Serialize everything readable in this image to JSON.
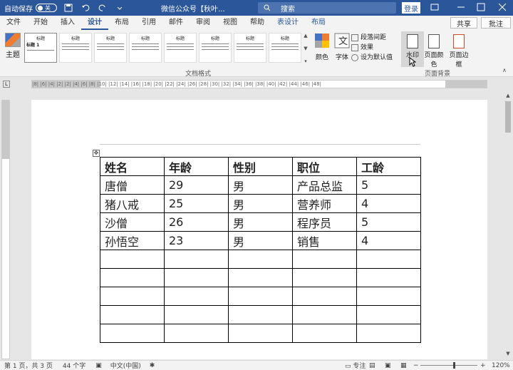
{
  "titlebar": {
    "autosave_label": "自动保存",
    "autosave_state": "关",
    "doc_title": "微信公众号【秋叶...",
    "search_placeholder": "搜索",
    "login_label": "登录"
  },
  "menu": {
    "tabs": [
      "文件",
      "开始",
      "插入",
      "设计",
      "布局",
      "引用",
      "邮件",
      "审阅",
      "视图",
      "帮助",
      "表设计",
      "布局"
    ],
    "active_index": 3,
    "share_label": "共享",
    "comment_label": "批注"
  },
  "ribbon": {
    "theme_label": "主题",
    "style_thumbs": [
      "标题",
      "标题",
      "标题",
      "标题",
      "标题",
      "标题",
      "标题",
      "标题"
    ],
    "first_thumb_sub": "标题 1",
    "group_doc_format": "文档格式",
    "colors_label": "颜色",
    "fonts_label": "字体",
    "paragraph_spacing": "段落间距",
    "effects": "效果",
    "set_default": "设为默认值",
    "watermark_label": "水印",
    "page_color_label": "页面颜色",
    "page_border_label": "页面边框",
    "group_page_bg": "页面背景"
  },
  "ruler": {
    "top_numbers": "|8|  |6|  |4|  |2|   |2|  |4|  |6|  |8|  |10| |12| |14| |16| |18| |20| |22| |24| |26| |28| |30| |32| |34| |36| |38| |40| |42| |44| |46| |48|",
    "corner": "L"
  },
  "table": {
    "headers": [
      "姓名",
      "年龄",
      "性别",
      "职位",
      "工龄"
    ],
    "rows": [
      [
        "唐僧",
        "29",
        "男",
        "产品总监",
        "5"
      ],
      [
        "猪八戒",
        "25",
        "男",
        "营养师",
        "4"
      ],
      [
        "沙僧",
        "26",
        "男",
        "程序员",
        "5"
      ],
      [
        "孙悟空",
        "23",
        "男",
        "销售",
        "4"
      ],
      [
        "",
        "",
        "",
        "",
        ""
      ],
      [
        "",
        "",
        "",
        "",
        ""
      ],
      [
        "",
        "",
        "",
        "",
        ""
      ],
      [
        "",
        "",
        "",
        "",
        ""
      ],
      [
        "",
        "",
        "",
        "",
        ""
      ],
      [
        "",
        "",
        "",
        "",
        ""
      ]
    ]
  },
  "status": {
    "page": "第 1 页，共 3 页",
    "words": "44 个字",
    "lang": "中文(中国)",
    "focus": "专注",
    "zoom": "120%"
  },
  "colors": {
    "titlebar": "#2b579a",
    "accent": "#2b579a"
  }
}
